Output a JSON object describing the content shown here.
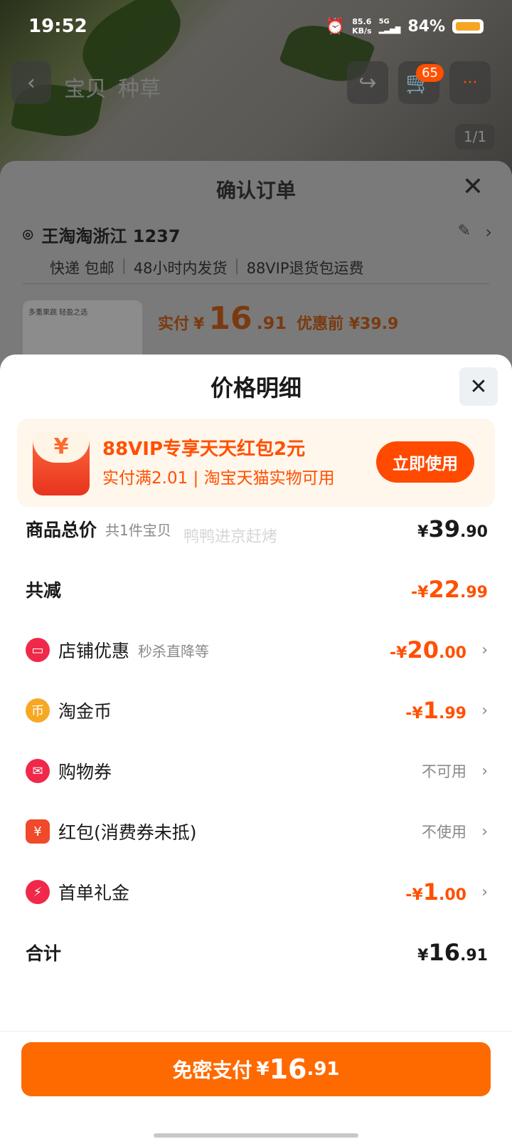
{
  "status": {
    "time": "19:52",
    "net_speed_top": "85.6",
    "net_speed_bottom": "KB/s",
    "signal_label": "5G",
    "battery": "84%"
  },
  "product_page": {
    "tabs": [
      "宝贝",
      "种草"
    ],
    "cart_badge": "65",
    "more_badge": "···",
    "image_pager": "1/1"
  },
  "order": {
    "title": "确认订单",
    "address_name": "王淘淘浙江 1237",
    "delivery": [
      "快递 包邮",
      "48小时内发货",
      "88VIP退货包运费"
    ],
    "product_thumb_text": "多重果蔬 轻盈之选",
    "paid_label": "实付",
    "paid_currency": "¥",
    "paid_int": "16",
    "paid_dec": ".91",
    "before_label": "优惠前 ¥39.9"
  },
  "price_detail": {
    "title": "价格明细",
    "promo": {
      "icon_char": "¥",
      "line1": "88VIP专享天天红包2元",
      "line2": "实付满2.01 | 淘宝天猫实物可用",
      "button": "立即使用"
    },
    "watermark": "鸭鸭进京赶烤",
    "rows": [
      {
        "label": "商品总价",
        "sub": "共1件宝贝",
        "cur": "¥",
        "int": "39",
        "dec": ".90"
      },
      {
        "label": "共减",
        "cur": "-¥",
        "int": "22",
        "dec": ".99"
      },
      {
        "label": "店铺优惠",
        "sub": "秒杀直降等",
        "cur": "-¥",
        "int": "20",
        "dec": ".00"
      },
      {
        "label": "淘金币",
        "cur": "-¥",
        "int": "1",
        "dec": ".99"
      },
      {
        "label": "购物券",
        "text": "不可用"
      },
      {
        "label": "红包(消费券未抵)",
        "text": "不使用"
      },
      {
        "label": "首单礼金",
        "cur": "-¥",
        "int": "1",
        "dec": ".00"
      },
      {
        "label": "合计",
        "cur": "¥",
        "int": "16",
        "dec": ".91"
      }
    ],
    "pay": {
      "label": "免密支付",
      "cur": "¥",
      "int": "16",
      "dec": ".91"
    }
  },
  "colors": {
    "accent": "#ff5000",
    "pay_button": "#ff6a00"
  }
}
